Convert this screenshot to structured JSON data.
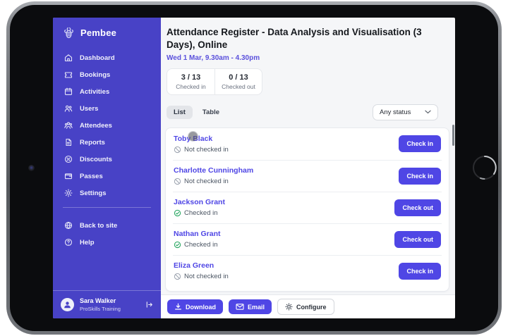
{
  "brand": {
    "name": "Pembee"
  },
  "sidebar": {
    "items": [
      {
        "label": "Dashboard",
        "icon": "home-icon"
      },
      {
        "label": "Bookings",
        "icon": "ticket-icon"
      },
      {
        "label": "Activities",
        "icon": "calendar-icon"
      },
      {
        "label": "Users",
        "icon": "users-icon"
      },
      {
        "label": "Attendees",
        "icon": "attendees-icon"
      },
      {
        "label": "Reports",
        "icon": "document-icon"
      },
      {
        "label": "Discounts",
        "icon": "discount-icon"
      },
      {
        "label": "Passes",
        "icon": "wallet-icon"
      },
      {
        "label": "Settings",
        "icon": "gear-icon"
      }
    ],
    "secondary": [
      {
        "label": "Back to site",
        "icon": "globe-icon"
      },
      {
        "label": "Help",
        "icon": "help-icon"
      }
    ],
    "user": {
      "name": "Sara Walker",
      "org": "ProSkills Training"
    }
  },
  "header": {
    "title": "Attendance Register - Data Analysis and Visualisation (3 Days), Online",
    "datetime": "Wed 1 Mar, 9.30am - 4.30pm"
  },
  "stats": [
    {
      "value": "3 / 13",
      "label": "Checked in"
    },
    {
      "value": "0 / 13",
      "label": "Checked out"
    }
  ],
  "view_tabs": [
    {
      "label": "List",
      "active": true
    },
    {
      "label": "Table",
      "active": false
    }
  ],
  "status_filter": {
    "value": "Any status"
  },
  "attendees": [
    {
      "name": "Toby Black",
      "status": "Not checked in",
      "checked": false,
      "action": "Check in"
    },
    {
      "name": "Charlotte Cunningham",
      "status": "Not checked in",
      "checked": false,
      "action": "Check in"
    },
    {
      "name": "Jackson Grant",
      "status": "Checked in",
      "checked": true,
      "action": "Check out"
    },
    {
      "name": "Nathan Grant",
      "status": "Checked in",
      "checked": true,
      "action": "Check out"
    },
    {
      "name": "Eliza Green",
      "status": "Not checked in",
      "checked": false,
      "action": "Check in"
    }
  ],
  "footer": {
    "download_label": "Download",
    "email_label": "Email",
    "configure_label": "Configure"
  },
  "colors": {
    "sidebar": "#4842C6",
    "accent": "#4F46E5",
    "checked_in_green": "#1FA35B",
    "muted_text": "#6B7280"
  }
}
